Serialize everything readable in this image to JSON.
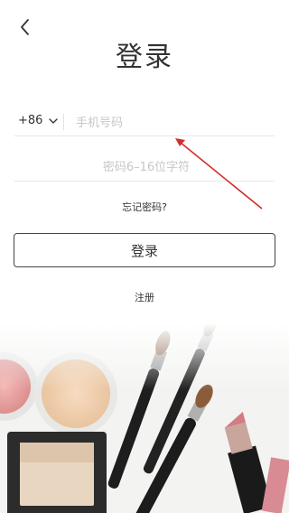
{
  "header": {
    "title": "登录",
    "back_icon": "back-arrow-icon"
  },
  "phone": {
    "country_code": "+86",
    "placeholder": "手机号码",
    "value": ""
  },
  "password": {
    "placeholder": "密码6–16位字符",
    "value": ""
  },
  "links": {
    "forgot": "忘记密码?",
    "register": "注册"
  },
  "actions": {
    "login_label": "登录"
  },
  "colors": {
    "annotation_arrow": "#d62b2b",
    "text": "#333333",
    "placeholder": "#c7c7c7"
  }
}
